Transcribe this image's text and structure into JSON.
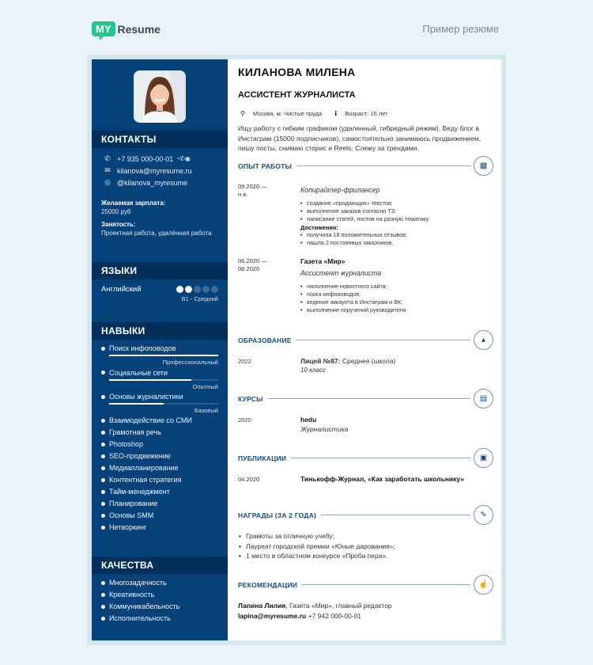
{
  "header": {
    "logo_badge": "MY",
    "logo_text": "Resume",
    "sample_link": "Пример резюме"
  },
  "sidebar": {
    "contacts_title": "КОНТАКТЫ",
    "phone": "+7 935 000-00-01",
    "email": "kilanova@myresume.ru",
    "instagram": "@kilanova_myresume",
    "salary_label": "Желаемая зарплата:",
    "salary_value": "25000 руб",
    "employment_label": "Занятость:",
    "employment_value": "Проектная работа, удалённая работа",
    "languages_title": "ЯЗЫКИ",
    "languages": [
      {
        "name": "Английский",
        "level": "B1 - Средний",
        "rating": 2,
        "max": 5
      }
    ],
    "skills_title": "НАВЫКИ",
    "rated_skills": [
      {
        "name": "Поиск инфоповодов",
        "level": "Профессиональный",
        "fraction": 1.0
      },
      {
        "name": "Социальные сети",
        "level": "Опытный",
        "fraction": 0.75
      },
      {
        "name": "Основы журналистики",
        "level": "Базовый",
        "fraction": 0.5
      }
    ],
    "skills": [
      "Взаимодействие со СМИ",
      "Грамотная речь",
      "Photoshop",
      "SEO-продвижение",
      "Медиапланирование",
      "Контентная стратегия",
      "Тайм-менеджмент",
      "Планирование",
      "Основы SMM",
      "Нетворкинг"
    ],
    "qualities_title": "КАЧЕСТВА",
    "qualities": [
      "Многозадачность",
      "Креативность",
      "Коммуникабельность",
      "Исполнительность"
    ]
  },
  "main": {
    "name": "КИЛАНОВА МИЛЕНА",
    "position": "АССИСТЕНТ ЖУРНАЛИСТА",
    "location": "Москва, м. Чистые пруда",
    "age": "Возраст: 16 лет",
    "summary": "Ищу работу с гибким графиком (удаленный, гибридный режим). Веду блог в Инстаграм (15000 подписчиков), самостоятельно занимаюсь продвижением, пишу посты, снимаю сторис и Reels. Слежу за трендами.",
    "experience": {
      "title": "ОПЫТ РАБОТЫ",
      "icon": "briefcase-icon",
      "jobs": [
        {
          "date_from": "09.2020 —",
          "date_to": "н.в.",
          "org": "",
          "role": "Копирайтер-фрилансер",
          "duties": [
            "создание «продающих» текстов;",
            "выполнение заказов согласно ТЗ;",
            "написание статей, постов на разную тематику."
          ],
          "achievements_label": "Достижения:",
          "achievements": [
            "получила 18 положительных отзывов;",
            "нашла 2 постоянных заказчиков."
          ]
        },
        {
          "date_from": "06.2020 —",
          "date_to": "08.2020",
          "org": "Газета «Мир»",
          "role": "Ассистент журналиста",
          "duties": [
            "наполнение новостного сайта;",
            "поиск инфоповодов;",
            "ведение аккаунта в Инстаграм и ВК;",
            "выполнение поручений руководителя"
          ]
        }
      ]
    },
    "education": {
      "title": "ОБРАЗОВАНИЕ",
      "icon": "graduation-cap-icon",
      "year": "2022",
      "school": "Лицей №87:",
      "degree": " Среднее (школа)",
      "detail": "10 класс"
    },
    "courses": {
      "title": "КУРСЫ",
      "icon": "document-icon",
      "year": "2020",
      "org": "hedu",
      "name": "Журналистика"
    },
    "publications": {
      "title": "ПУБЛИКАЦИИ",
      "icon": "book-icon",
      "date": "04.2020",
      "name": "Тинькофф-Журнал, «Как заработать школьнику»"
    },
    "awards": {
      "title": "НАГРАДЫ (ЗА 2 ГОДА)",
      "icon": "pencil-icon",
      "items": [
        "Грамоты за отличную учебу;",
        "Лауреат городской премии «Юные дарования»;",
        "1 место в областном конкурсе «Проба пера»."
      ]
    },
    "references": {
      "title": "РЕКОМЕНДАЦИИ",
      "icon": "thumbs-up-icon",
      "person": "Лапина Лилия",
      "details": ", Газета «Мир», главный редактор",
      "email": "lapina@myresume.ru",
      "phone": " +7 942 000-00-01"
    }
  }
}
